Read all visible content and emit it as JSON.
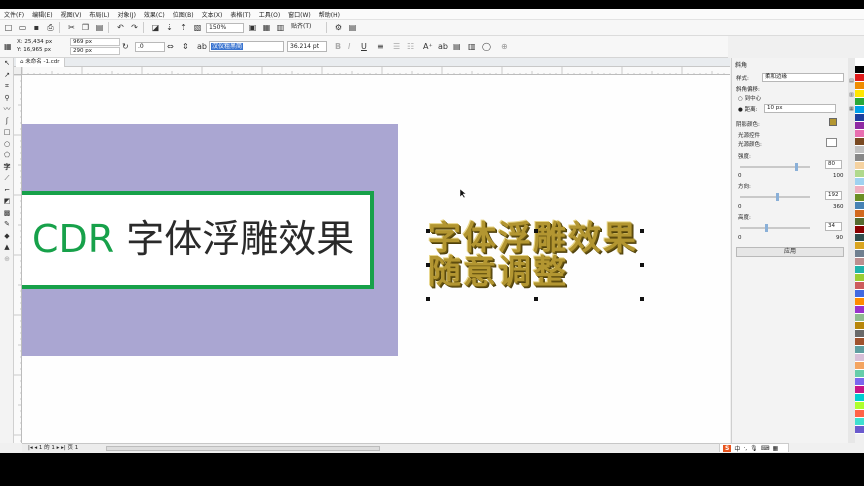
{
  "menus": [
    "文件(F)",
    "编辑(E)",
    "视图(V)",
    "布局(L)",
    "对象(J)",
    "效果(C)",
    "位图(B)",
    "文本(X)",
    "表格(T)",
    "工具(O)",
    "窗口(W)",
    "帮助(H)"
  ],
  "toolbar": {
    "zoom": "150%",
    "snap": "贴齐(T)"
  },
  "props": {
    "x": "X: 25,434 px",
    "y": "Y: 16,965 px",
    "width": "969 px",
    "height": "290 px",
    "angle": ".0",
    "font_name": "汉仪粗黑简",
    "font_size": "36.214 pt"
  },
  "tab": {
    "label": "未命名 -1.cdr"
  },
  "canvas": {
    "title_latin": "CDR",
    "title_cn": "字体浮雕效果",
    "gold_line1": "字体浮雕效果",
    "gold_line2": "随意调整"
  },
  "panel": {
    "title": "斜角",
    "style_label": "样式:",
    "style_value": "柔和边缘",
    "offset_label": "斜角偏移:",
    "to_center": "到中心",
    "distance_label": "距离:",
    "distance_value": "10 px",
    "shadow_color": "阴影颜色:",
    "light_ctrl": "光源控件",
    "light_color": "光源颜色:",
    "intensity_label": "强度:",
    "intensity_value": "80",
    "intensity_min": "0",
    "intensity_max": "100",
    "direction_label": "方向:",
    "direction_value": "192",
    "direction_min": "0",
    "direction_max": "360",
    "height_label": "高度:",
    "height_value": "34",
    "height_min": "0",
    "height_max": "90",
    "apply": "应用",
    "levels": {
      "intensity": 0.8,
      "direction": 0.533,
      "height": 0.378
    }
  },
  "status": {
    "page_info": "1 的 1",
    "page_tab": "页 1"
  },
  "ime": {
    "logo": "S",
    "lang": "中"
  },
  "colors": {
    "accent_green": "#17a14a",
    "purple_bg": "#aaa6d2",
    "gold": "#b39631"
  },
  "palette": [
    "#ffffff",
    "#000000",
    "#e01a1a",
    "#f08c00",
    "#ffe600",
    "#2aa838",
    "#00a0e9",
    "#1d3f9e",
    "#8f2aa3",
    "#e86fb0",
    "#7a4a22",
    "#c2c2c2",
    "#888888",
    "#f5d2a0",
    "#b0d98c",
    "#9fd2f0",
    "#f0b0c0",
    "#6b8e23",
    "#4682b4",
    "#d2691e",
    "#556b2f",
    "#8b0000",
    "#2f4f4f",
    "#daa520",
    "#708090",
    "#bc8f8f",
    "#20b2aa",
    "#9acd32",
    "#cd5c5c",
    "#4169e1",
    "#ff8c00",
    "#9932cc",
    "#8fbc8f",
    "#b8860b",
    "#696969",
    "#a0522d",
    "#5f9ea0",
    "#d8bfd8",
    "#f4a460",
    "#66cdaa",
    "#7b68ee",
    "#c71585",
    "#00ced1",
    "#adff2f",
    "#ff6347",
    "#40e0d0",
    "#6a5acd"
  ]
}
